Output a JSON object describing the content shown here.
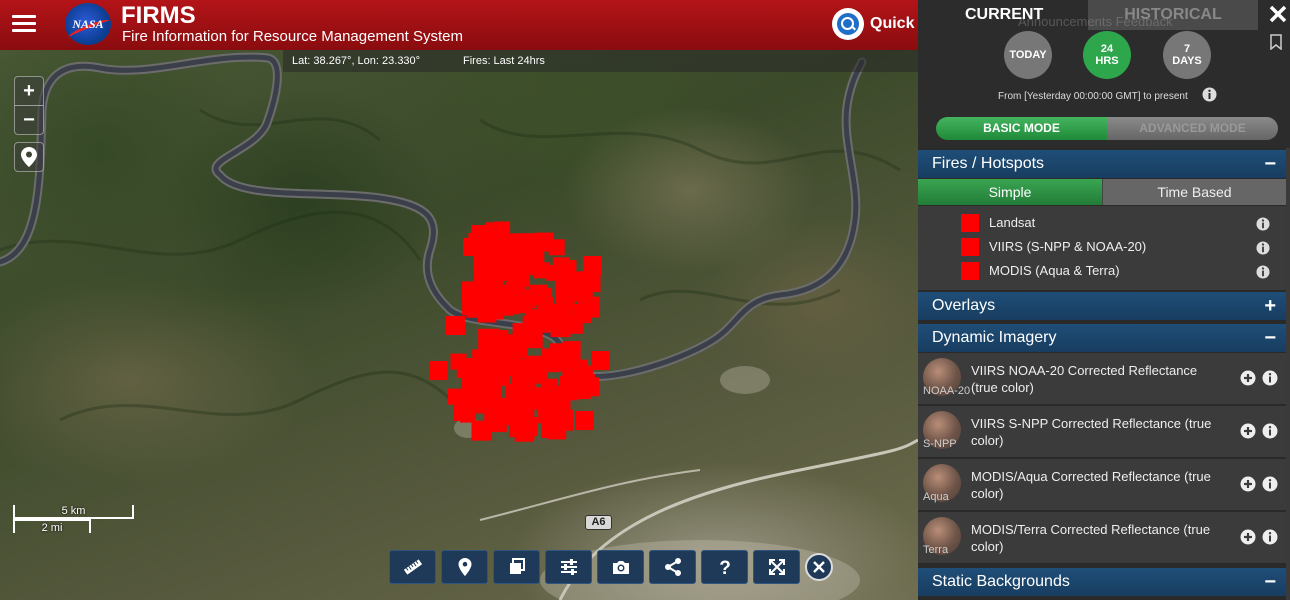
{
  "header": {
    "logo_text": "NASA",
    "title": "FIRMS",
    "subtitle": "Fire Information for Resource Management System",
    "quick_search_label": "Quick Search"
  },
  "coord_bar": {
    "coords": "Lat: 38.267°, Lon: 23.330°",
    "fires": "Fires: Last 24hrs"
  },
  "map_controls": {
    "zoom_in": "+",
    "zoom_out": "−"
  },
  "scale": {
    "km": "5 km",
    "mi": "2 mi"
  },
  "road_shield": "A6",
  "toolbar": [
    "ruler-icon",
    "map-pin-icon",
    "layers-icon",
    "sliders-icon",
    "camera-icon",
    "share-icon",
    "help-icon",
    "fullscreen-icon"
  ],
  "toolbar_help_glyph": "?",
  "panel": {
    "tab_current": "CURRENT",
    "tab_historical": "HISTORICAL",
    "ghost_links": "Announcements   Feedback",
    "period_today": "TODAY",
    "period_24_top": "24",
    "period_24_bottom": "HRS",
    "period_7_top": "7",
    "period_7_bottom": "DAYS",
    "period_range": "From [Yesterday 00:00:00 GMT] to present",
    "mode_basic": "BASIC MODE",
    "mode_advanced": "ADVANCED MODE",
    "sections": {
      "fires": "Fires / Hotspots",
      "overlays": "Overlays",
      "dynamic": "Dynamic Imagery",
      "static": "Static Backgrounds"
    },
    "toggle_minus": "−",
    "toggle_plus": "+",
    "fire_tabs": {
      "simple": "Simple",
      "time_based": "Time Based"
    },
    "fire_layers": [
      {
        "label": "Landsat"
      },
      {
        "label": "VIIRS (S-NPP & NOAA-20)"
      },
      {
        "label": "MODIS (Aqua & Terra)"
      }
    ],
    "imagery": [
      {
        "tag": "NOAA-20",
        "label": "VIIRS NOAA-20 Corrected Reflectance (true color)"
      },
      {
        "tag": "S-NPP",
        "label": "VIIRS S-NPP Corrected Reflectance (true color)"
      },
      {
        "tag": "Aqua",
        "label": "MODIS/Aqua Corrected Reflectance (true color)"
      },
      {
        "tag": "Terra",
        "label": "MODIS/Terra Corrected Reflectance (true color)"
      }
    ]
  },
  "colors": {
    "header_red": "#a01014",
    "fire_red": "#ff0000",
    "active_green": "#2ea74c",
    "section_blue": "#1f4e78"
  }
}
